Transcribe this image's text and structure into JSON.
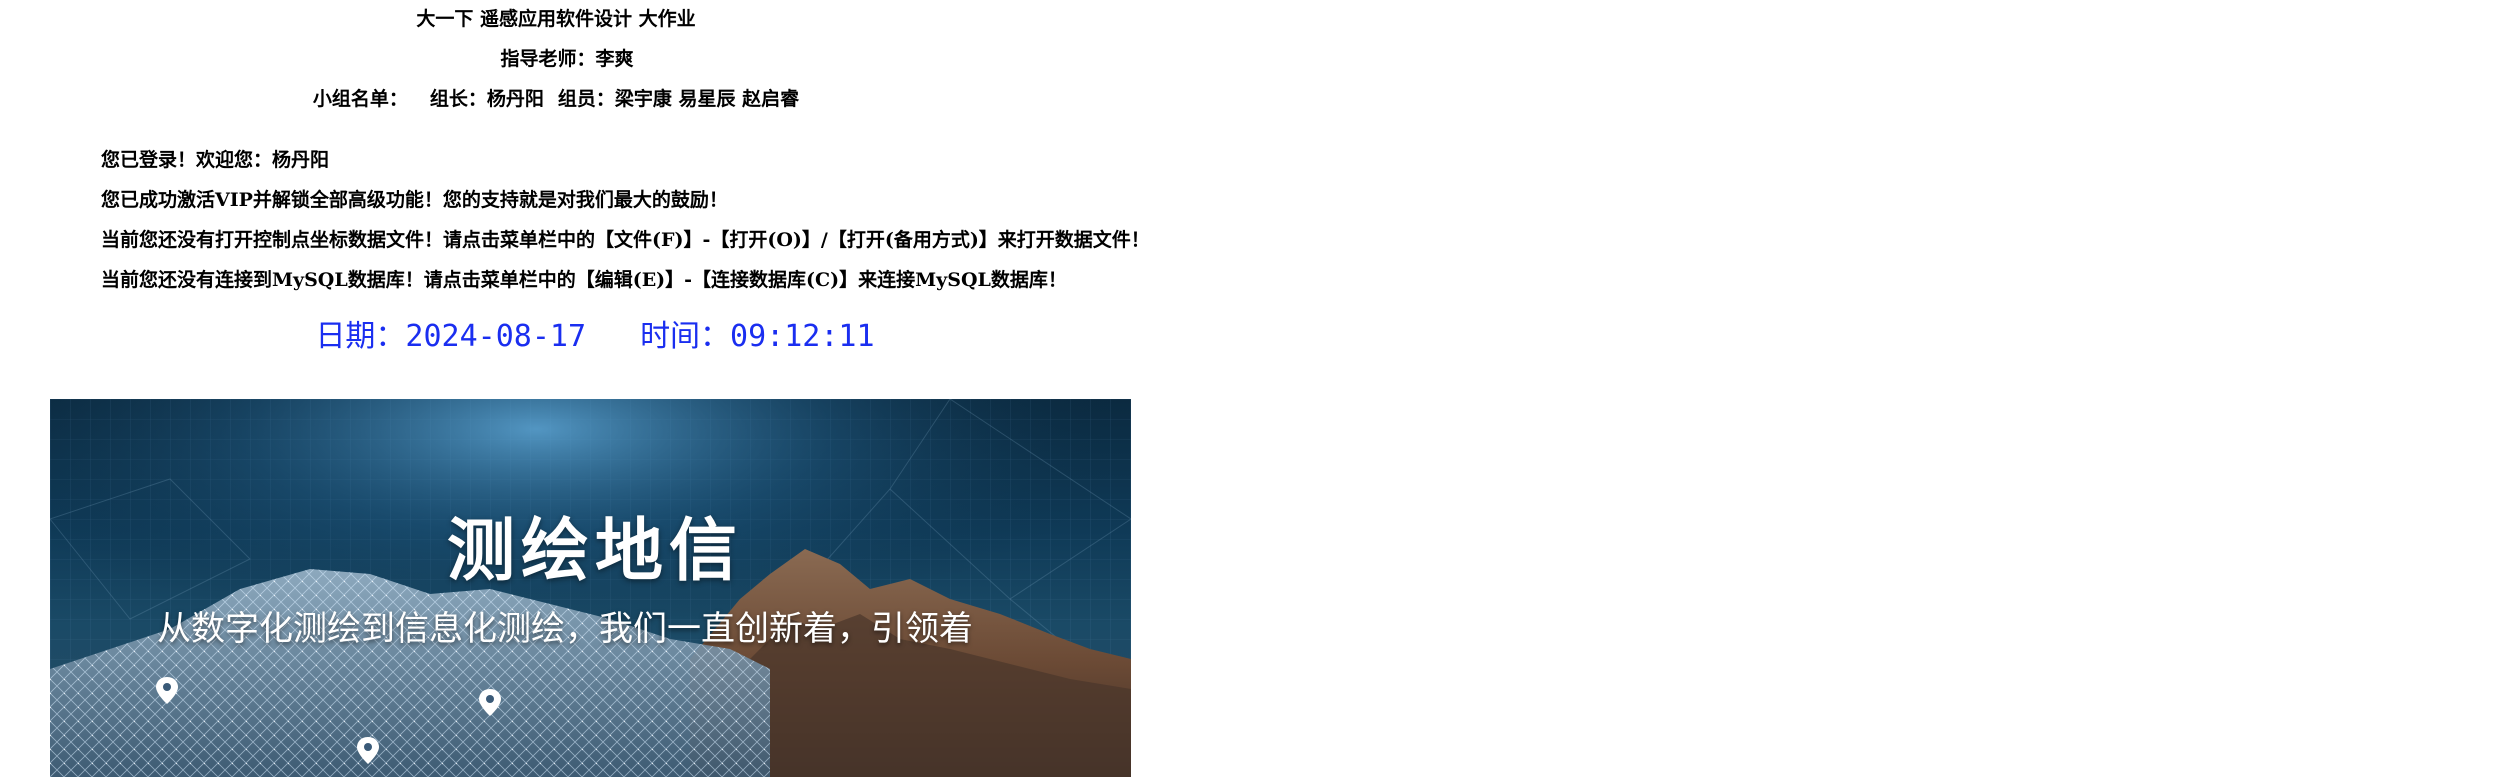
{
  "header": {
    "title": "大一下 遥感应用软件设计 大作业",
    "teacher": "指导老师：李爽",
    "members_label": "小组名单：",
    "leader": "组长：杨丹阳",
    "members": "组员：梁宇康 易星辰 赵启睿"
  },
  "messages": {
    "login": "您已登录！欢迎您：杨丹阳",
    "vip": "您已成功激活VIP并解锁全部高级功能！您的支持就是对我们最大的鼓励！",
    "no_file": "当前您还没有打开控制点坐标数据文件！请点击菜单栏中的【文件(F)】-【打开(O)】/【打开(备用方式)】来打开数据文件！",
    "no_db": "当前您还没有连接到MySQL数据库！请点击菜单栏中的【编辑(E)】-【连接数据库(C)】来连接MySQL数据库！"
  },
  "datetime": {
    "date": "日期：2024-08-17",
    "time": "时间：09:12:11"
  },
  "banner": {
    "title": "测绘地信",
    "subtitle": "从数字化测绘到信息化测绘，我们一直创新着，引领着"
  },
  "colors": {
    "clock": "#1a2ef0",
    "banner_sky": "#0f3a57",
    "mountain": "#6b4a35"
  },
  "icons": [
    "location-pin-icon",
    "location-pin-icon",
    "location-pin-icon"
  ]
}
